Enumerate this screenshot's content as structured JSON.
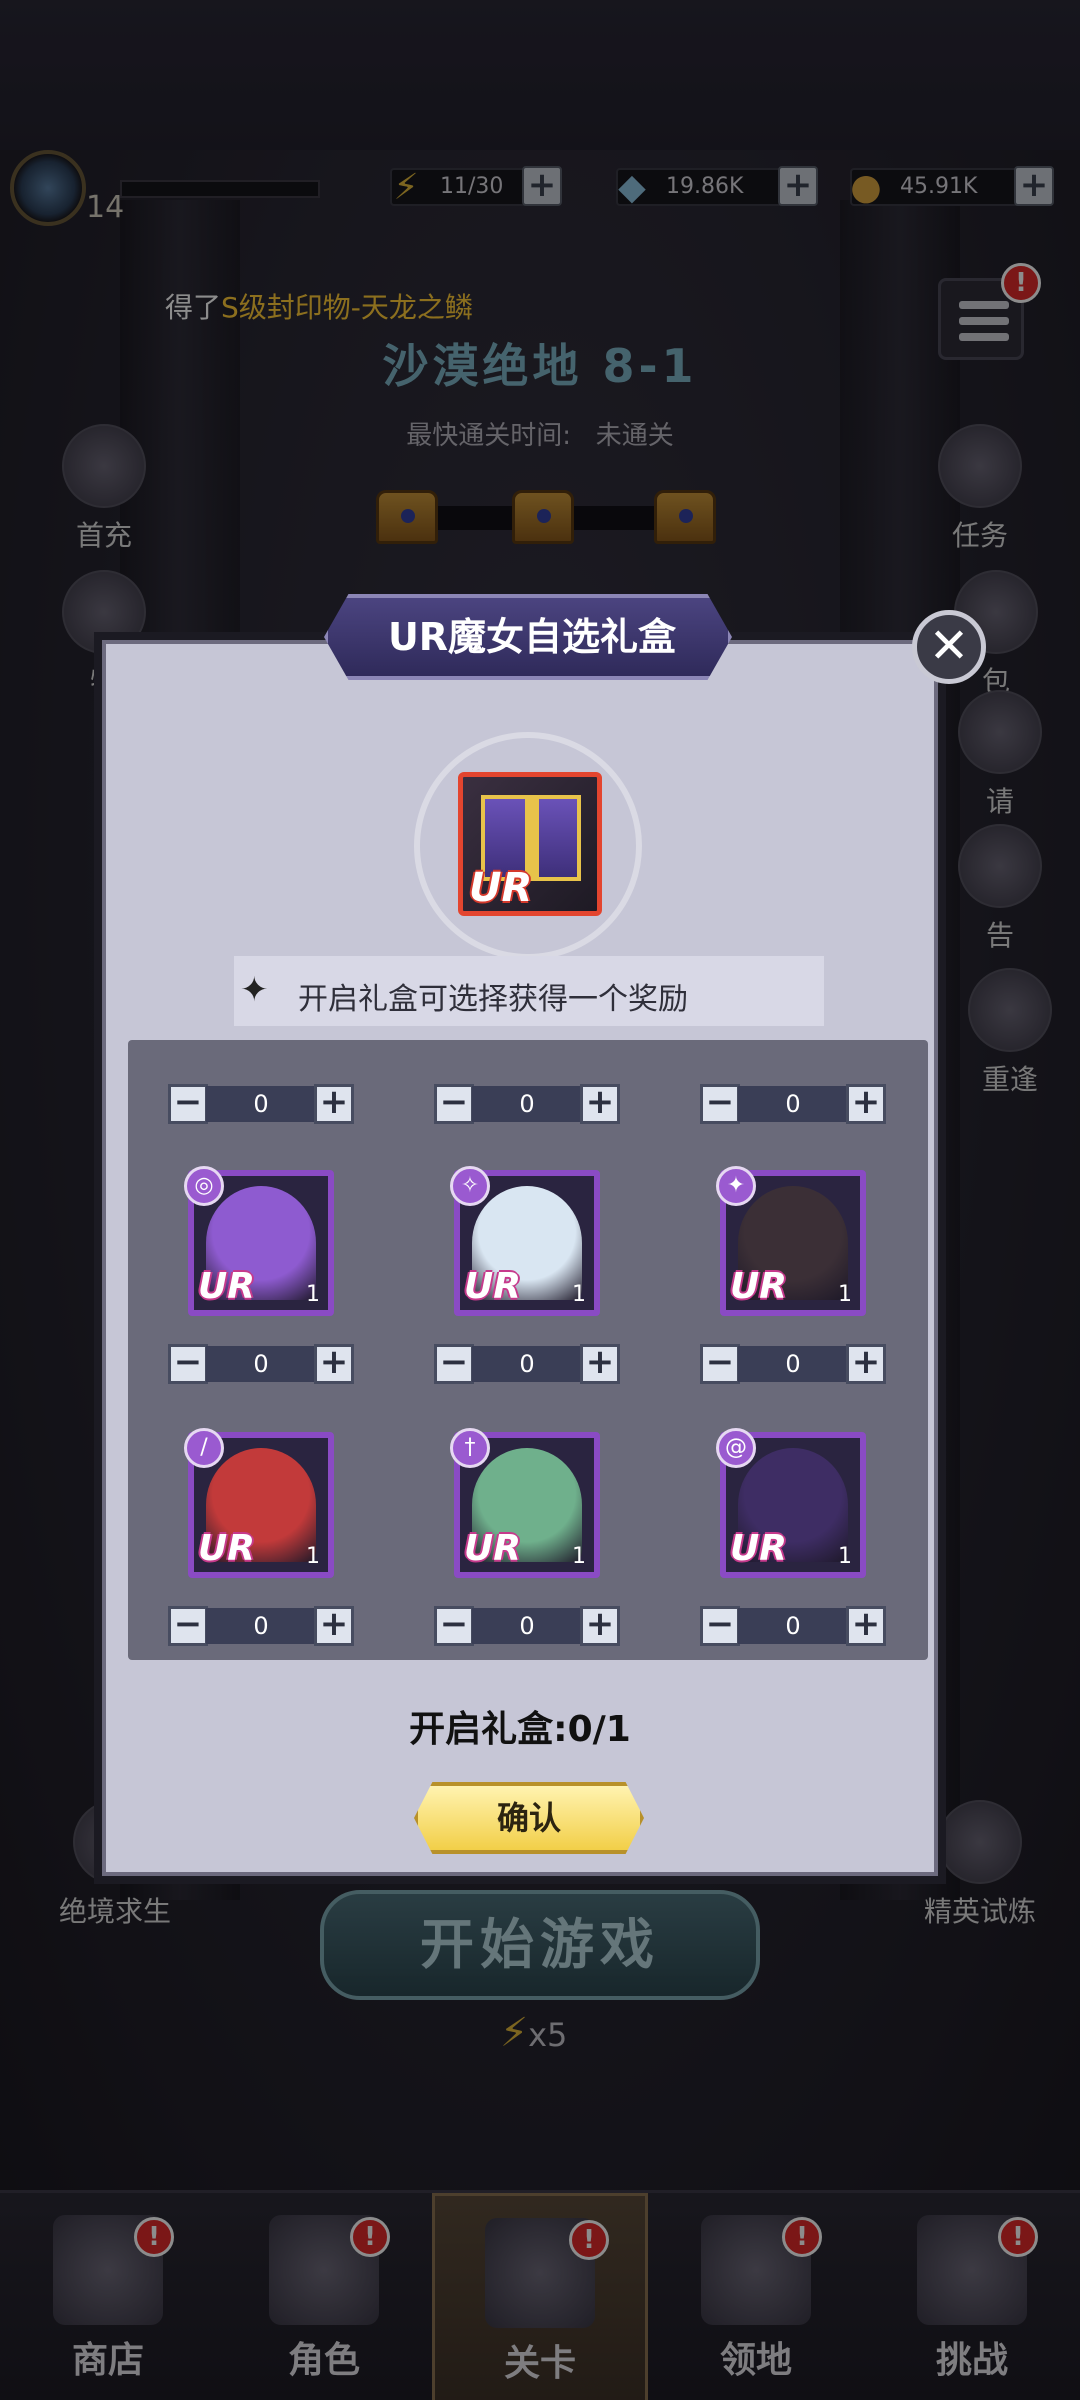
{
  "topbar": {
    "level": "14",
    "energy": "11/30",
    "gems": "19.86K",
    "coins": "45.91K",
    "icons": [
      "level-emblem-icon",
      "lightning-icon",
      "gem-icon",
      "coin-icon"
    ]
  },
  "notice": {
    "prefix": "得了",
    "item": "S级封印物-天龙之鳞"
  },
  "stage": {
    "title": "沙漠绝地 8-1",
    "fast_label": "最快通关时间:",
    "fast_value": "未通关"
  },
  "side_left": [
    {
      "label": "首充"
    },
    {
      "label": "特"
    },
    {
      "label": "绝境求生"
    }
  ],
  "side_right": [
    {
      "label": "任务"
    },
    {
      "label": "包"
    },
    {
      "label": "请"
    },
    {
      "label": "告"
    },
    {
      "label": "重逢"
    },
    {
      "label": "精英试炼"
    }
  ],
  "start": {
    "label": "开始游戏",
    "cost": "x5"
  },
  "bottom_nav": [
    {
      "label": "商店",
      "badge": "!"
    },
    {
      "label": "角色",
      "badge": "!"
    },
    {
      "label": "关卡",
      "badge": "!"
    },
    {
      "label": "领地",
      "badge": "!"
    },
    {
      "label": "挑战",
      "badge": "!"
    }
  ],
  "modal": {
    "title": "UR魔女自选礼盒",
    "gift_ur": "UR",
    "description": "开启礼盒可选择获得一个奖励",
    "open_count": "开启礼盒:0/1",
    "confirm_label": "确认",
    "close_symbol": "✕",
    "top_steppers": [
      "0",
      "0",
      "0"
    ],
    "slots": [
      {
        "ur": "UR",
        "count": "1",
        "value": "0",
        "class_icon": "target-icon",
        "color": "#8e5bd0"
      },
      {
        "ur": "UR",
        "count": "1",
        "value": "0",
        "class_icon": "staff-icon",
        "color": "#d9e6f2"
      },
      {
        "ur": "UR",
        "count": "1",
        "value": "0",
        "class_icon": "wand-icon",
        "color": "#3b2f36"
      },
      {
        "ur": "UR",
        "count": "1",
        "value": "0",
        "class_icon": "sword-icon",
        "color": "#c23a3a"
      },
      {
        "ur": "UR",
        "count": "1",
        "value": "0",
        "class_icon": "dagger-icon",
        "color": "#6fb08c"
      },
      {
        "ur": "UR",
        "count": "1",
        "value": "0",
        "class_icon": "swirl-icon",
        "color": "#3e2d64"
      }
    ]
  }
}
